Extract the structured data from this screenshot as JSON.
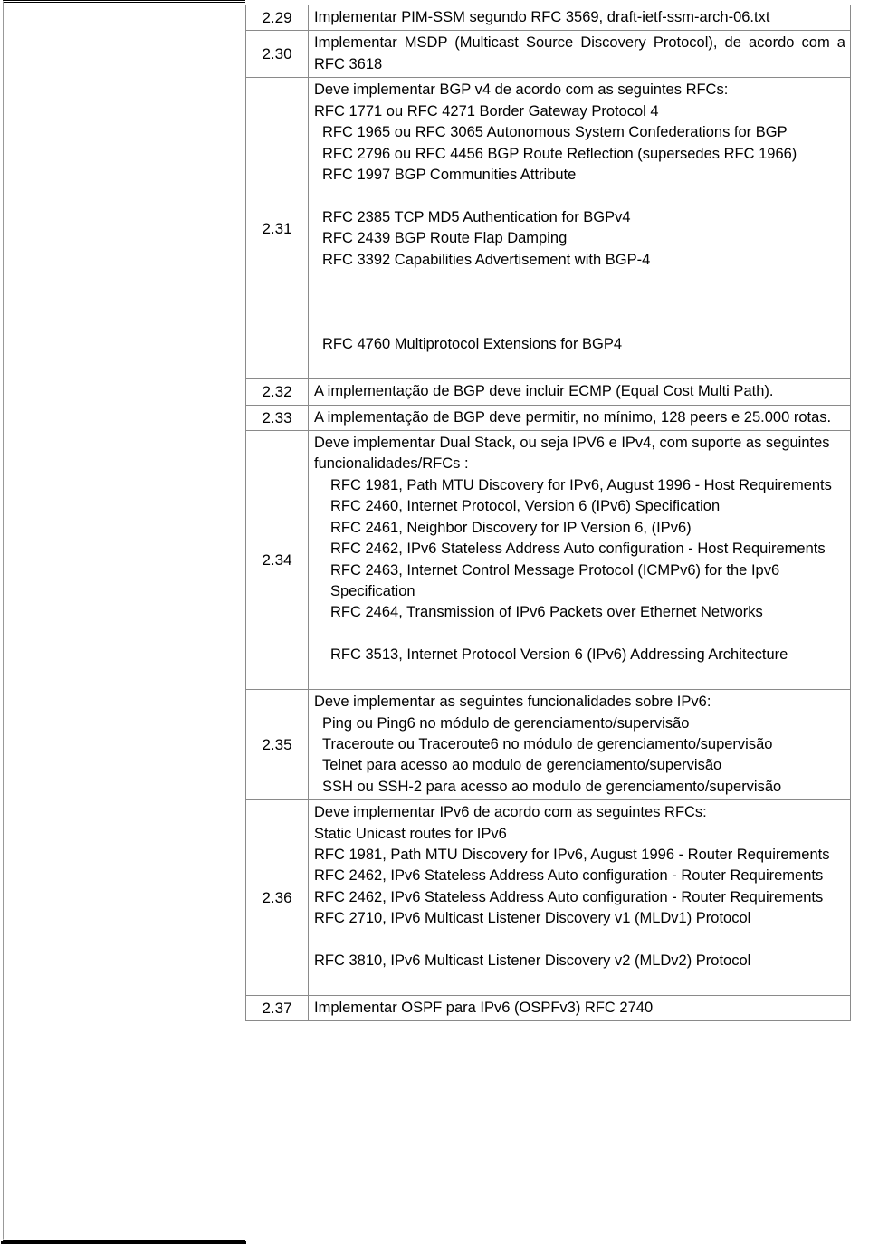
{
  "document": {
    "type": "requirements-table",
    "columns": [
      "item",
      "description"
    ],
    "rows": [
      {
        "id": "2.29",
        "align": "justify",
        "lines": [
          {
            "text": "Implementar PIM-SSM segundo RFC 3569, draft-ietf-ssm-arch-06.txt",
            "style": "just"
          }
        ]
      },
      {
        "id": "2.30",
        "align": "justify",
        "lines": [
          {
            "text": "Implementar MSDP (Multicast Source Discovery Protocol), de acordo com a RFC 3618",
            "style": "just"
          }
        ]
      },
      {
        "id": "2.31",
        "align": "left",
        "lines": [
          {
            "text": "Deve implementar BGP v4 de acordo com as seguintes RFCs:",
            "style": "plain"
          },
          {
            "text": "RFC 1771 ou RFC 4271 Border Gateway Protocol 4",
            "style": "plain"
          },
          {
            "text": "RFC 1965 ou RFC 3065 Autonomous System Confederations for BGP",
            "style": "ind1"
          },
          {
            "text": "RFC 2796 ou RFC 4456 BGP Route Reflection (supersedes RFC 1966)",
            "style": "ind1"
          },
          {
            "text": "RFC 1997 BGP Communities Attribute",
            "style": "ind1"
          },
          {
            "text": "",
            "style": "blank"
          },
          {
            "text": "RFC 2385 TCP MD5 Authentication for BGPv4",
            "style": "ind1"
          },
          {
            "text": "RFC 2439 BGP Route Flap Damping",
            "style": "ind1"
          },
          {
            "text": "RFC 3392 Capabilities Advertisement with BGP-4",
            "style": "ind1"
          },
          {
            "text": "",
            "style": "blank"
          },
          {
            "text": "",
            "style": "blank"
          },
          {
            "text": "",
            "style": "blank"
          },
          {
            "text": "RFC 4760 Multiprotocol Extensions  for BGP4",
            "style": "ind1"
          },
          {
            "text": "",
            "style": "blank"
          }
        ]
      },
      {
        "id": "2.32",
        "align": "justify",
        "lines": [
          {
            "text": "A implementação de BGP deve incluir ECMP (Equal Cost Multi Path).",
            "style": "just"
          }
        ]
      },
      {
        "id": "2.33",
        "align": "justify",
        "lines": [
          {
            "text": "A implementação de BGP deve permitir, no mínimo, 128 peers e 25.000 rotas.",
            "style": "just"
          }
        ]
      },
      {
        "id": "2.34",
        "align": "left",
        "lines": [
          {
            "text": "Deve implementar Dual Stack, ou seja IPV6 e IPv4, com suporte as seguintes funcionalidades/RFCs :",
            "style": "plain"
          },
          {
            "text": "RFC 1981, Path MTU Discovery for IPv6, August 1996 - Host Requirements",
            "style": "ind2"
          },
          {
            "text": "RFC 2460, Internet Protocol, Version 6 (IPv6) Specification",
            "style": "ind2"
          },
          {
            "text": "RFC 2461, Neighbor Discovery for IP Version 6, (IPv6)",
            "style": "ind2"
          },
          {
            "text": "RFC 2462, IPv6 Stateless Address Auto configuration - Host Requirements",
            "style": "ind2"
          },
          {
            "text": "RFC 2463, Internet Control Message Protocol (ICMPv6) for the Ipv6 Specification",
            "style": "ind2"
          },
          {
            "text": "RFC 2464, Transmission of IPv6 Packets over Ethernet Networks",
            "style": "ind2"
          },
          {
            "text": "",
            "style": "blank"
          },
          {
            "text": "RFC 3513, Internet Protocol Version 6 (IPv6) Addressing Architecture",
            "style": "ind2"
          },
          {
            "text": "",
            "style": "blank"
          }
        ]
      },
      {
        "id": "2.35",
        "align": "left",
        "lines": [
          {
            "text": "Deve implementar as seguintes funcionalidades sobre IPv6:",
            "style": "plain"
          },
          {
            "text": "Ping ou Ping6 no módulo de gerenciamento/supervisão",
            "style": "ind1"
          },
          {
            "text": "Traceroute ou Traceroute6 no módulo de gerenciamento/supervisão",
            "style": "ind1"
          },
          {
            "text": "Telnet para acesso ao modulo de gerenciamento/supervisão",
            "style": "ind1"
          },
          {
            "text": "SSH ou SSH-2 para acesso ao modulo de gerenciamento/supervisão",
            "style": "ind1"
          }
        ]
      },
      {
        "id": "2.36",
        "align": "left",
        "lines": [
          {
            "text": "Deve implementar IPv6 de acordo com as seguintes RFCs:",
            "style": "plain"
          },
          {
            "text": "Static Unicast routes for IPv6",
            "style": "plain"
          },
          {
            "text": "RFC 1981, Path MTU Discovery for IPv6, August 1996 - Router Requirements",
            "style": "plain"
          },
          {
            "text": "RFC 2462, IPv6 Stateless Address Auto configuration - Router Requirements",
            "style": "plain"
          },
          {
            "text": "RFC 2462, IPv6 Stateless Address Auto configuration - Router Requirements",
            "style": "plain"
          },
          {
            "text": "RFC 2710, IPv6 Multicast Listener Discovery v1 (MLDv1) Protocol",
            "style": "plain"
          },
          {
            "text": "",
            "style": "blank"
          },
          {
            "text": "RFC 3810, IPv6 Multicast Listener Discovery v2 (MLDv2) Protocol",
            "style": "plain"
          },
          {
            "text": "",
            "style": "blank"
          }
        ]
      },
      {
        "id": "2.37",
        "align": "left",
        "lines": [
          {
            "text": "Implementar OSPF para IPv6 (OSPFv3) RFC 2740",
            "style": "plain"
          }
        ]
      }
    ]
  },
  "colors": {
    "text": "#000000",
    "border": "#8a8a8a",
    "rule": "#000000",
    "background": "#ffffff"
  }
}
